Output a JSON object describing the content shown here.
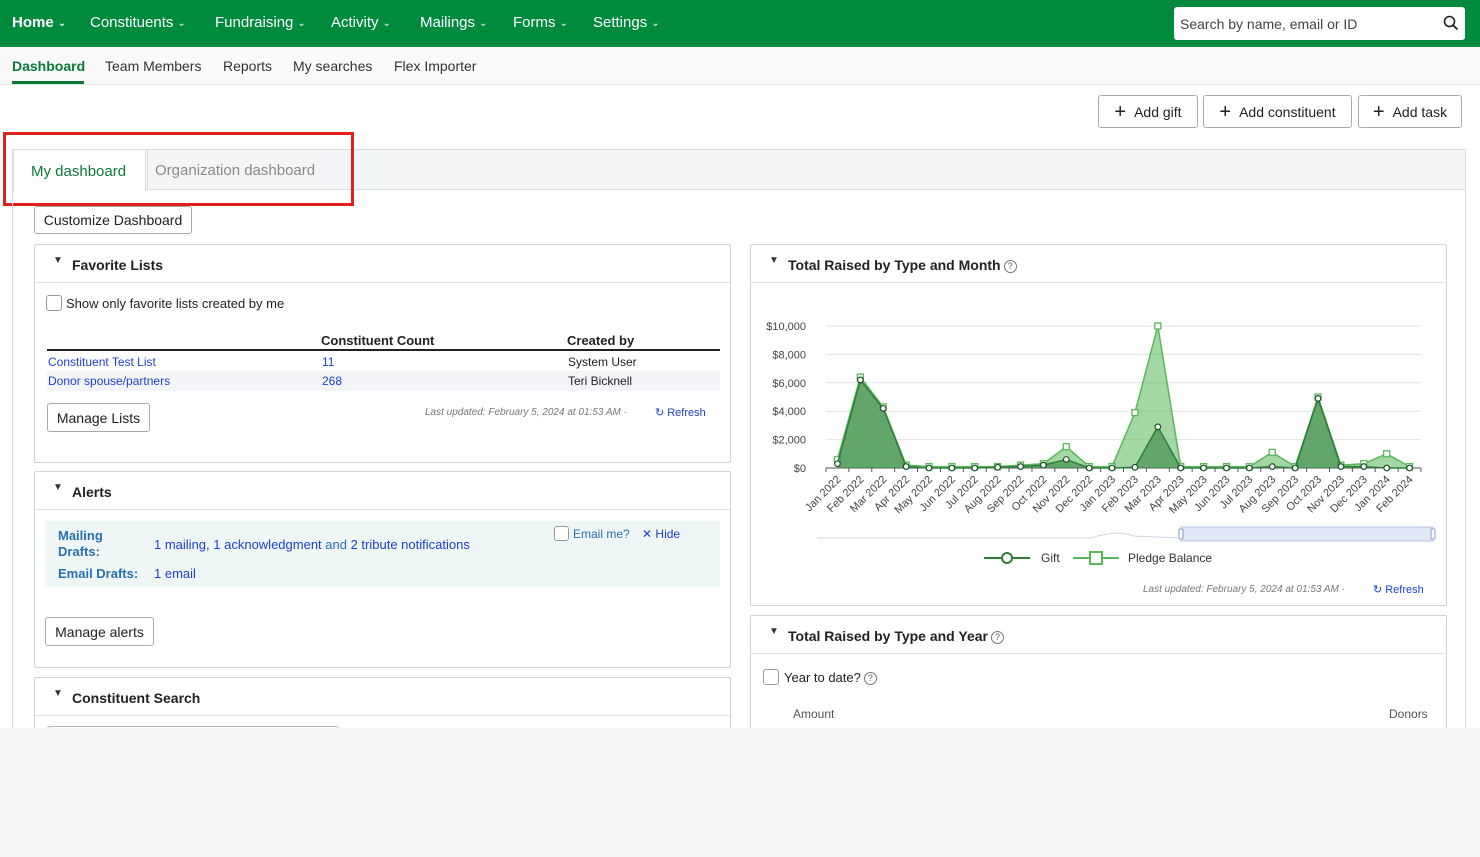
{
  "topnav": {
    "items": [
      {
        "label": "Home"
      },
      {
        "label": "Constituents"
      },
      {
        "label": "Fundraising"
      },
      {
        "label": "Activity"
      },
      {
        "label": "Mailings"
      },
      {
        "label": "Forms"
      },
      {
        "label": "Settings"
      }
    ],
    "caret": "⌄",
    "search_placeholder": "Search by name, email or ID",
    "search_icon": "search-icon"
  },
  "subnav": {
    "items": [
      {
        "label": "Dashboard",
        "active": true
      },
      {
        "label": "Team Members"
      },
      {
        "label": "Reports"
      },
      {
        "label": "My searches"
      },
      {
        "label": "Flex Importer"
      }
    ]
  },
  "actions": {
    "add_gift": "Add gift",
    "add_constituent": "Add constituent",
    "add_task": "Add task",
    "plus": "+"
  },
  "tabs": {
    "my": "My dashboard",
    "org": "Organization dashboard"
  },
  "customize_label": "Customize Dashboard",
  "favorite_lists": {
    "title": "Favorite Lists",
    "checkbox_label": "Show only favorite lists created by me",
    "columns": [
      "",
      "Constituent Count",
      "Created by"
    ],
    "rows": [
      {
        "name": "Constituent Test List",
        "count": "11",
        "created_by": "System User"
      },
      {
        "name": "Donor spouse/partners",
        "count": "268",
        "created_by": "Teri Bicknell"
      }
    ],
    "manage_label": "Manage Lists",
    "last_updated": "Last updated: February 5, 2024 at 01:53 AM ·",
    "refresh_label": "Refresh"
  },
  "alerts": {
    "title": "Alerts",
    "mailing_drafts_label": "Mailing Drafts:",
    "mailing_link1": "1 mailing",
    "mailing_sep1": ", ",
    "mailing_link2": "1 acknowledgment",
    "mailing_and": " and ",
    "mailing_link3": "2 tribute notifications",
    "email_drafts_label": "Email Drafts:",
    "email_link": "1 email",
    "email_me": "Email me?",
    "hide": "Hide",
    "manage_label": "Manage alerts"
  },
  "constituent_search": {
    "title": "Constituent Search"
  },
  "raised_month": {
    "title": "Total Raised by Type and Month",
    "last_updated": "Last updated: February 5, 2024 at 01:53 AM ·",
    "refresh_label": "Refresh"
  },
  "raised_year": {
    "title": "Total Raised by Type and Year",
    "checkbox_label": "Year to date?",
    "col_amount": "Amount",
    "col_donors": "Donors"
  },
  "colors": {
    "nav_green": "#008a3e",
    "link_blue": "#1d3fd0",
    "gift_green": "#2e7d3a",
    "pledge_green": "#58b85a",
    "highlight_red": "#e0211d"
  },
  "chart_data": {
    "type": "area",
    "categories": [
      "Jan 2022",
      "Feb 2022",
      "Mar 2022",
      "Apr 2022",
      "May 2022",
      "Jun 2022",
      "Jul 2022",
      "Aug 2022",
      "Sep 2022",
      "Oct 2022",
      "Nov 2022",
      "Dec 2022",
      "Jan 2023",
      "Feb 2023",
      "Mar 2023",
      "Apr 2023",
      "May 2023",
      "Jun 2023",
      "Jul 2023",
      "Aug 2023",
      "Sep 2023",
      "Oct 2023",
      "Nov 2023",
      "Dec 2023",
      "Jan 2024",
      "Feb 2024"
    ],
    "y_ticks": [
      "$0",
      "$2,000",
      "$4,000",
      "$6,000",
      "$8,000",
      "$10,000"
    ],
    "ylim": [
      0,
      10000
    ],
    "series": [
      {
        "name": "Gift",
        "values": [
          300,
          6200,
          4200,
          100,
          0,
          0,
          0,
          50,
          100,
          200,
          600,
          0,
          0,
          50,
          2900,
          0,
          0,
          0,
          0,
          100,
          0,
          4900,
          100,
          100,
          0,
          0
        ]
      },
      {
        "name": "Pledge Balance",
        "values": [
          600,
          6400,
          4300,
          200,
          100,
          100,
          100,
          100,
          200,
          300,
          1500,
          100,
          100,
          3900,
          10000,
          100,
          100,
          100,
          100,
          1100,
          100,
          5000,
          200,
          300,
          1000,
          100
        ]
      }
    ],
    "legend": "bottom-center",
    "grid": true
  }
}
